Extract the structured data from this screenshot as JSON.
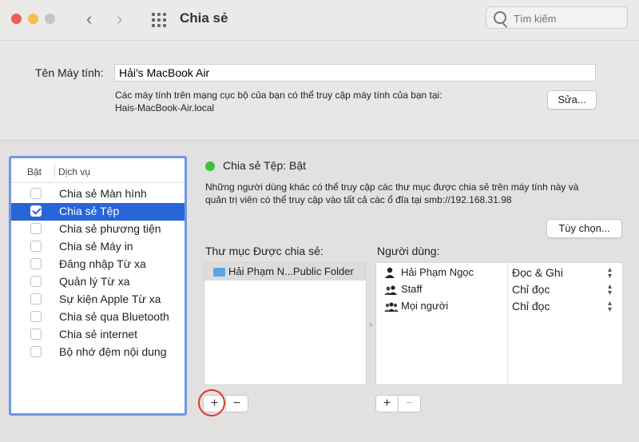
{
  "window": {
    "title": "Chia sẻ"
  },
  "search": {
    "placeholder": "Tìm kiếm"
  },
  "computer_name": {
    "label": "Tên Máy tính:",
    "value": "Hải's MacBook Air",
    "description": "Các máy tính trên mạng cục bộ của bạn có thể truy cập máy tính của bạn tại:",
    "address": "Hais-MacBook-Air.local",
    "edit_button": "Sửa..."
  },
  "services": {
    "header_on": "Bật",
    "header_service": "Dịch vụ",
    "items": [
      {
        "label": "Chia sẻ Màn hình",
        "checked": false
      },
      {
        "label": "Chia sẻ Tệp",
        "checked": true
      },
      {
        "label": "Chia sẻ phương tiện",
        "checked": false
      },
      {
        "label": "Chia sẻ Máy in",
        "checked": false
      },
      {
        "label": "Đăng nhập Từ xa",
        "checked": false
      },
      {
        "label": "Quản lý Từ xa",
        "checked": false
      },
      {
        "label": "Sự kiện Apple Từ xa",
        "checked": false
      },
      {
        "label": "Chia sẻ qua Bluetooth",
        "checked": false
      },
      {
        "label": "Chia sẻ internet",
        "checked": false
      },
      {
        "label": "Bộ nhớ đệm nội dung",
        "checked": false
      }
    ]
  },
  "file_sharing": {
    "status": "Chia sẻ Tệp: Bật",
    "status_color": "#3fbf3f",
    "description_line1": "Những người dùng khác có thể truy cập các thư mục được chia sẻ trên máy tính này và",
    "description_line2": "quản trị viên có thể truy cập vào tất cả các ổ đĩa tại smb://192.168.31.98",
    "options_button": "Tùy chọn...",
    "shared_folders_label": "Thư mục Được chia sẻ:",
    "shared_folders": [
      "Hải Phạm N...Public Folder"
    ],
    "users_label": "Người dùng:",
    "users": [
      {
        "name": "Hải Phạm Ngọc",
        "icon": "user-icon",
        "permission": "Đọc & Ghi"
      },
      {
        "name": "Staff",
        "icon": "group-icon",
        "permission": "Chỉ đọc"
      },
      {
        "name": "Mọi người",
        "icon": "everyone-icon",
        "permission": "Chỉ đọc"
      }
    ],
    "add_symbol": "+",
    "remove_symbol": "−"
  },
  "colors": {
    "accent": "#2865d8",
    "highlight_ring": "#d93a2b"
  }
}
